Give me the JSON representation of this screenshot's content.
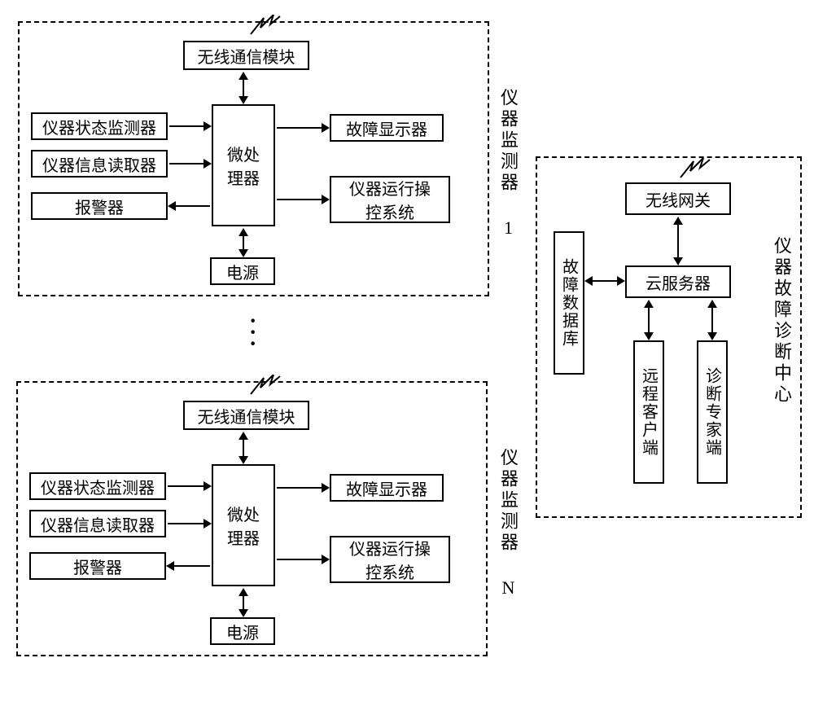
{
  "monitor": {
    "wireless_module": "无线通信模块",
    "status_monitor": "仪器状态监测器",
    "info_reader": "仪器信息读取器",
    "alarm": "报警器",
    "microprocessor": "微处\n理器",
    "fault_display": "故障显示器",
    "control_system": "仪器运行操\n控系统",
    "power": "电源"
  },
  "monitor_labels": {
    "label_1": "仪器监测器 1",
    "label_n": "仪器监测器 N"
  },
  "diagnostic_center": {
    "outer_label": "仪器故障诊断中心",
    "gateway": "无线网关",
    "cloud": "云服务器",
    "fault_db": "故障数据库",
    "remote_client": "远程客户端",
    "expert_end": "诊断专家端"
  }
}
